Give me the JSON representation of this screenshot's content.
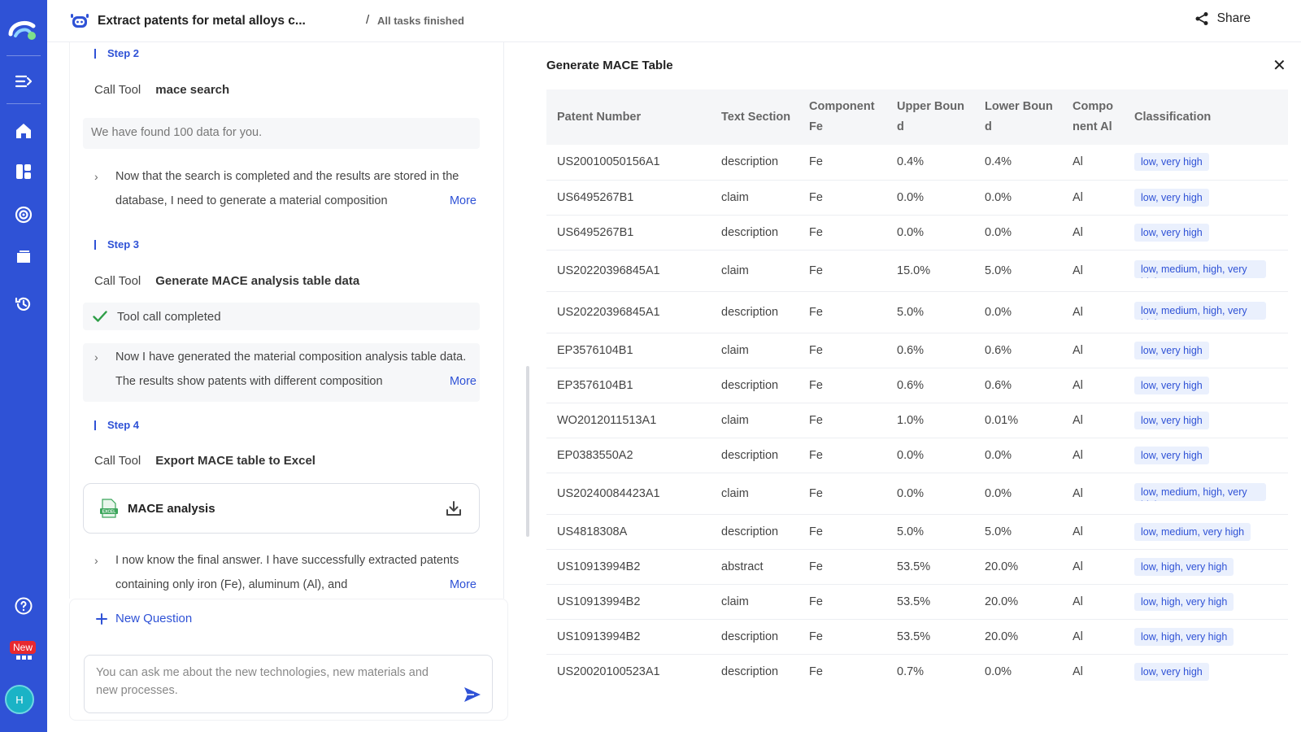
{
  "header": {
    "title": "Extract patents for metal alloys c...",
    "separator": "/",
    "status": "All tasks finished",
    "share_label": "Share"
  },
  "sidebar": {
    "new_badge": "New",
    "avatar_initial": "H",
    "icons": [
      "logo-icon",
      "collapse-icon",
      "home-icon",
      "dashboard-icon",
      "radar-icon",
      "folder-icon",
      "history-icon",
      "help-icon",
      "apps-icon"
    ]
  },
  "chat": {
    "step2": {
      "label": "Step 2",
      "call_prefix": "Call Tool",
      "tool": "mace search",
      "result": "We have found 100 data for you.",
      "thought": "Now that the search is completed and the results are stored in the database, I need to generate a material composition",
      "more": "More"
    },
    "step3": {
      "label": "Step 3",
      "call_prefix": "Call Tool",
      "tool": "Generate MACE analysis table data",
      "result": "Tool call completed",
      "thought": "Now I have generated the material composition analysis table data. The results show patents with different composition",
      "more": "More"
    },
    "step4": {
      "label": "Step 4",
      "call_prefix": "Call Tool",
      "tool": "Export MACE table to Excel",
      "file_name": "MACE analysis",
      "file_badge": "EXCEL",
      "thought": "I now know the final answer. I have successfully extracted patents containing only iron (Fe), aluminum (Al), and",
      "more": "More"
    }
  },
  "composer": {
    "new_question": "New Question",
    "placeholder": "You can ask me about the new technologies, new materials and new processes."
  },
  "table": {
    "title": "Generate MACE Table",
    "close": "✕",
    "columns": [
      "Patent Number",
      "Text Section",
      "Component Fe",
      "Upper Bound",
      "Lower Bound",
      "Component Al",
      "Classification"
    ],
    "rows": [
      [
        "US20010050156A1",
        "description",
        "Fe",
        "0.4%",
        "0.4%",
        "Al",
        "low, very high"
      ],
      [
        "US6495267B1",
        "claim",
        "Fe",
        "0.0%",
        "0.0%",
        "Al",
        "low, very high"
      ],
      [
        "US6495267B1",
        "description",
        "Fe",
        "0.0%",
        "0.0%",
        "Al",
        "low, very high"
      ],
      [
        "US20220396845A1",
        "claim",
        "Fe",
        "15.0%",
        "5.0%",
        "Al",
        "low, medium, high, very high"
      ],
      [
        "US20220396845A1",
        "description",
        "Fe",
        "5.0%",
        "0.0%",
        "Al",
        "low, medium, high, very high"
      ],
      [
        "EP3576104B1",
        "claim",
        "Fe",
        "0.6%",
        "0.6%",
        "Al",
        "low, very high"
      ],
      [
        "EP3576104B1",
        "description",
        "Fe",
        "0.6%",
        "0.6%",
        "Al",
        "low, very high"
      ],
      [
        "WO2012011513A1",
        "claim",
        "Fe",
        "1.0%",
        "0.01%",
        "Al",
        "low, very high"
      ],
      [
        "EP0383550A2",
        "description",
        "Fe",
        "0.0%",
        "0.0%",
        "Al",
        "low, very high"
      ],
      [
        "US20240084423A1",
        "claim",
        "Fe",
        "0.0%",
        "0.0%",
        "Al",
        "low, medium, high, very high"
      ],
      [
        "US4818308A",
        "description",
        "Fe",
        "5.0%",
        "5.0%",
        "Al",
        "low, medium, very high"
      ],
      [
        "US10913994B2",
        "abstract",
        "Fe",
        "53.5%",
        "20.0%",
        "Al",
        "low, high, very high"
      ],
      [
        "US10913994B2",
        "claim",
        "Fe",
        "53.5%",
        "20.0%",
        "Al",
        "low, high, very high"
      ],
      [
        "US10913994B2",
        "description",
        "Fe",
        "53.5%",
        "20.0%",
        "Al",
        "low, high, very high"
      ],
      [
        "US20020100523A1",
        "description",
        "Fe",
        "0.7%",
        "0.0%",
        "Al",
        "low, very high"
      ]
    ]
  },
  "colors": {
    "accent": "#2f52d6",
    "sidebar": "#2f52d6",
    "tag_bg": "#eaf0fd",
    "success": "#2e9e47"
  }
}
